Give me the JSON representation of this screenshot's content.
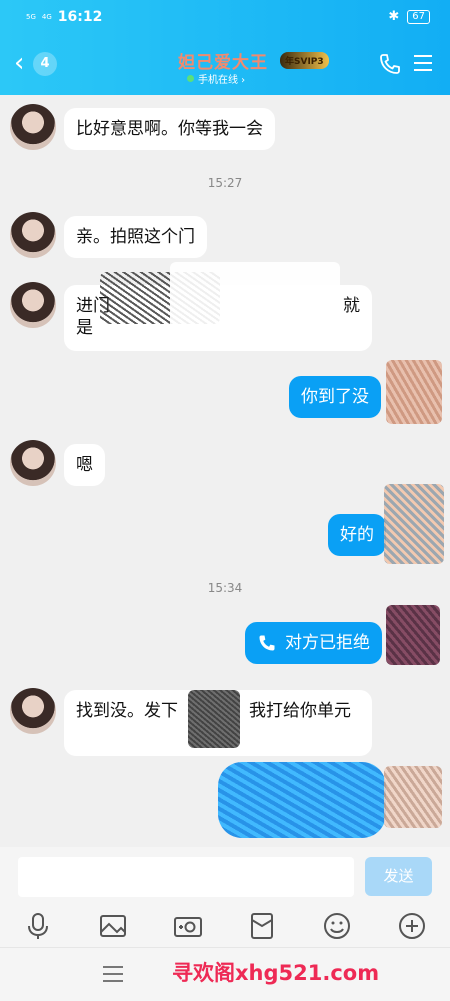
{
  "status_bar": {
    "signal1": "5G",
    "signal2": "4G",
    "time": "16:12",
    "battery": "67"
  },
  "header": {
    "unread_count": "4",
    "title": "妲己爱大王",
    "vip_badge": "年SVIP3",
    "subtitle": "手机在线 ›"
  },
  "messages": [
    {
      "side": "left",
      "text": "比好意思啊。你等我一会"
    },
    {
      "timestamp": "15:27"
    },
    {
      "side": "left",
      "text": "亲。拍照这个门"
    },
    {
      "side": "left",
      "text_line1": "进门",
      "text_line1_end": "就",
      "text_line2": "是"
    },
    {
      "side": "right",
      "text": "你到了没"
    },
    {
      "side": "left",
      "text": "嗯"
    },
    {
      "side": "right",
      "text": "好的"
    },
    {
      "timestamp": "15:34"
    },
    {
      "side": "right",
      "type": "call",
      "text": "对方已拒绝"
    },
    {
      "side": "left",
      "text_a": "找到没。发下",
      "text_b": "我打给你单元"
    }
  ],
  "input": {
    "placeholder": "",
    "send_label": "发送"
  },
  "toolbar": [
    "mic-icon",
    "image-icon",
    "camera-icon",
    "red-packet-icon",
    "emoji-icon",
    "plus-icon"
  ],
  "watermark": "寻欢阁xhg521.com",
  "colors": {
    "header": "#12aef4",
    "bubble_right": "#0aa0f5",
    "title": "#f38a6e",
    "watermark": "#ee2a55"
  }
}
